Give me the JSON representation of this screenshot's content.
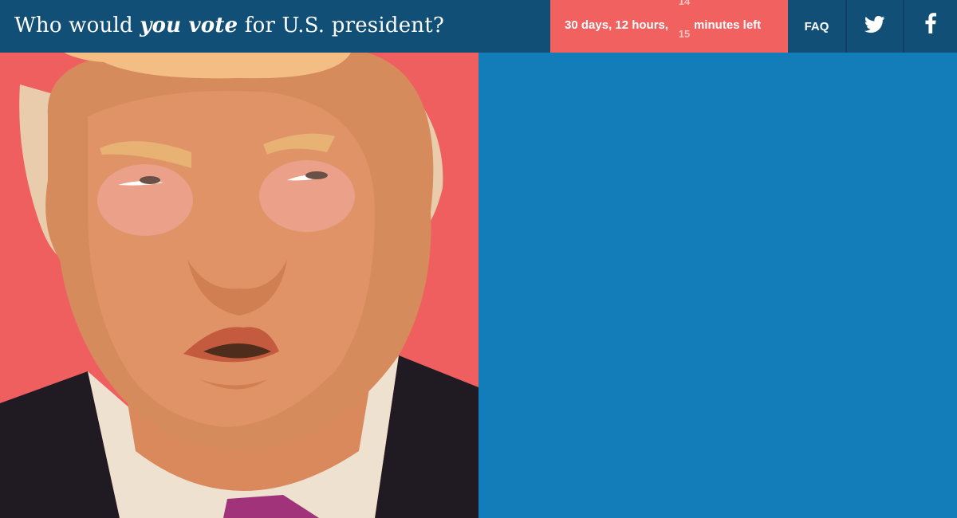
{
  "header": {
    "title_before": "Who would",
    "title_emphasis": "you vote",
    "title_after": "for U.S. president?"
  },
  "countdown": {
    "prefix": "30 days, 12 hours,",
    "minutes_previous": "14",
    "minutes_next": "15",
    "suffix": "minutes left"
  },
  "nav": {
    "faq_label": "FAQ",
    "twitter_icon": "twitter-icon",
    "facebook_icon": "facebook-icon"
  },
  "panels": {
    "left_candidate": "candidate-portrait",
    "colors": {
      "header": "#114f76",
      "countdown": "#f06160",
      "left_background": "#f05f5f",
      "right_background": "#137db9"
    }
  }
}
